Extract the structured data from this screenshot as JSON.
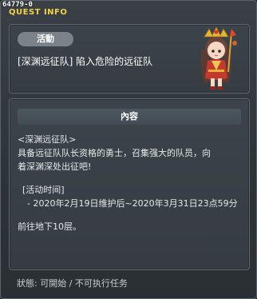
{
  "window": {
    "quest_id": "64779-0",
    "title": "QUEST INFO"
  },
  "quest": {
    "category": "活動",
    "title": "[深渊远征队] 陷入危险的远征队",
    "npc": "female-warrior-npc-portrait"
  },
  "content": {
    "header": "內容",
    "line1": "<深渊远征队>",
    "line2": "具备远征队队长资格的勇士，召集强大的队员，向",
    "line3": "着深渊深处出征吧!",
    "period_label": "[活动时间]",
    "period_value": "- 2020年2月19日维护后~2020年3月31日23点59分",
    "hint": "前往地下10层。"
  },
  "status": {
    "text": "狀態:  可開始 / 不可执行任务"
  },
  "colors": {
    "title_accent": "#f3d24b",
    "badge_bg": "#7b838a",
    "panel_bg": "#3c434a"
  }
}
